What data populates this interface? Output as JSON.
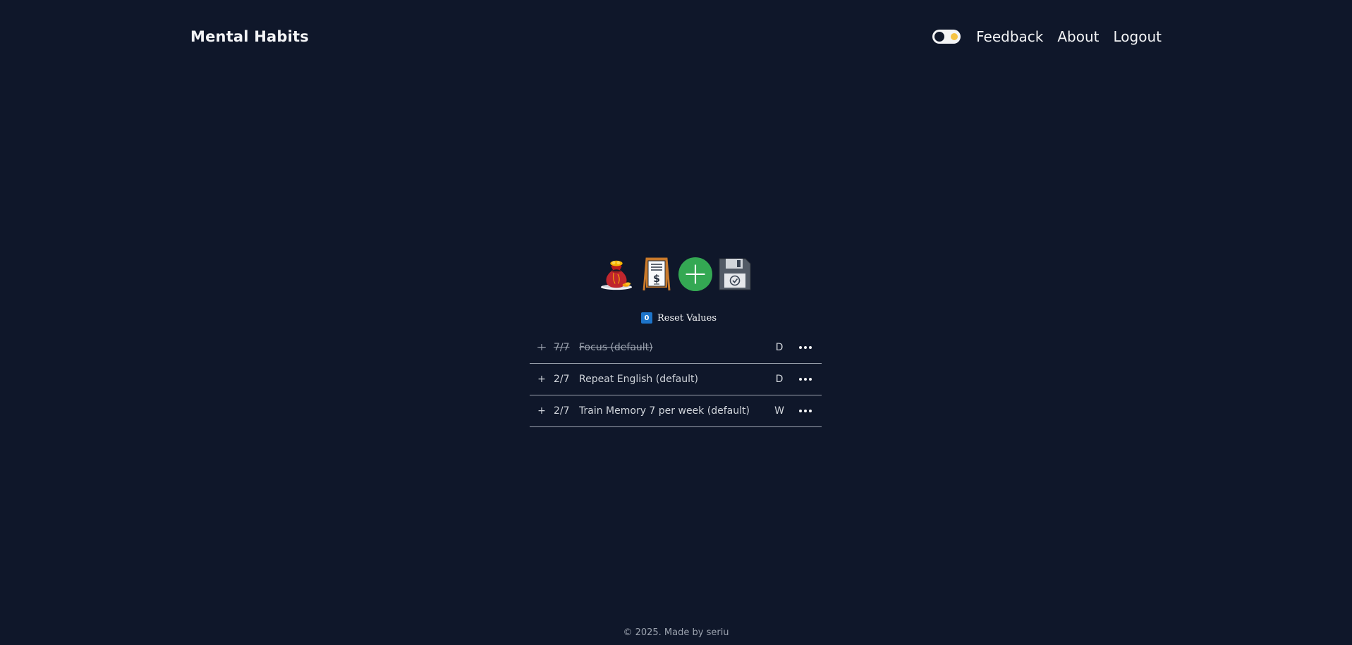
{
  "header": {
    "brand": "Mental Habits",
    "theme_toggle_icon": "dark-light-toggle",
    "nav": {
      "feedback": "Feedback",
      "about": "About",
      "logout": "Logout"
    }
  },
  "toolbar": {
    "items": [
      {
        "name": "money-bag-icon"
      },
      {
        "name": "price-board-icon"
      },
      {
        "name": "add-circle-icon"
      },
      {
        "name": "save-disk-icon"
      }
    ]
  },
  "reset": {
    "badge": "0",
    "label": "Reset Values"
  },
  "habits": [
    {
      "plus": "+",
      "count": "7/7",
      "name": "Focus (default)",
      "freq": "D",
      "done": true
    },
    {
      "plus": "+",
      "count": "2/7",
      "name": "Repeat English (default)",
      "freq": "D",
      "done": false
    },
    {
      "plus": "+",
      "count": "2/7",
      "name": "Train Memory 7 per week (default)",
      "freq": "W",
      "done": false
    }
  ],
  "footer": {
    "text": "© 2025. Made by seriu"
  },
  "colors": {
    "background": "#0f172a",
    "accent_green": "#34a853",
    "badge_blue": "#1d74c9"
  }
}
